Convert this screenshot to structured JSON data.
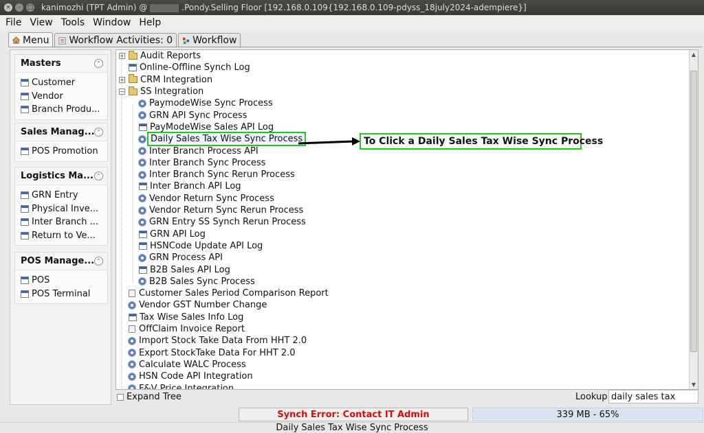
{
  "window": {
    "title_prefix": "kanimozhi (TPT Admin) @",
    "title_suffix": ".Pondy.Selling Floor [192.168.0.109{192.168.0.109-pdyss_18july2024-adempiere}]",
    "close_glyph": "×",
    "min_glyph": "–",
    "max_glyph": "□"
  },
  "menubar": [
    "File",
    "View",
    "Tools",
    "Window",
    "Help"
  ],
  "tabs": [
    {
      "label": "Menu",
      "icon": "home-icon"
    },
    {
      "label": "Workflow Activities: 0",
      "icon": "workflow-list-icon"
    },
    {
      "label": "Workflow",
      "icon": "workflow-icon"
    }
  ],
  "sidebar": {
    "masters": {
      "title": "Masters",
      "items": [
        "Customer",
        "Vendor",
        "Branch Produ..."
      ]
    },
    "sales": {
      "title": "Sales Manag...",
      "items": [
        "POS Promotion"
      ]
    },
    "logistics": {
      "title": "Logistics Ma...",
      "items": [
        "GRN Entry",
        "Physical Inve...",
        "Inter Branch ...",
        "Return to Ve..."
      ]
    },
    "pos": {
      "title": "POS Manage...",
      "items": [
        "POS",
        "POS Terminal"
      ]
    }
  },
  "tree": {
    "top": [
      {
        "label": "Audit Reports",
        "type": "folder",
        "expanded": false
      },
      {
        "label": "Online-Offline Synch Log",
        "type": "window"
      },
      {
        "label": "CRM Integration",
        "type": "folder",
        "expanded": false
      },
      {
        "label": "SS Integration",
        "type": "folder",
        "expanded": true
      }
    ],
    "ss_children": [
      {
        "label": "PaymodeWise Sync Process",
        "type": "process"
      },
      {
        "label": "GRN API Sync Process",
        "type": "process"
      },
      {
        "label": "PayModeWise Sales API Log",
        "type": "window"
      },
      {
        "label": "Daily Sales Tax Wise Sync Process",
        "type": "process",
        "selected": true
      },
      {
        "label": "Inter Branch Process API",
        "type": "process"
      },
      {
        "label": "Inter Branch Sync Process",
        "type": "process"
      },
      {
        "label": "Inter Branch Sync Rerun Process",
        "type": "process"
      },
      {
        "label": "Inter Branch API Log",
        "type": "window"
      },
      {
        "label": "Vendor Return Sync Process",
        "type": "process"
      },
      {
        "label": "Vendor Return Sync Rerun Process",
        "type": "process"
      },
      {
        "label": "GRN Entry SS Synch Rerun Process",
        "type": "process"
      },
      {
        "label": "GRN API Log",
        "type": "window"
      },
      {
        "label": "HSNCode Update API Log",
        "type": "window"
      },
      {
        "label": "GRN Process API",
        "type": "process"
      },
      {
        "label": "B2B Sales API Log",
        "type": "window"
      },
      {
        "label": "B2B Sales Sync Process",
        "type": "process"
      }
    ],
    "bottom": [
      {
        "label": "Customer Sales Period Comparison Report",
        "type": "report"
      },
      {
        "label": "Vendor GST Number Change",
        "type": "process"
      },
      {
        "label": "Tax Wise Sales Info Log",
        "type": "window"
      },
      {
        "label": "OffClaim Invoice Report",
        "type": "report"
      },
      {
        "label": "Import Stock Take Data From HHT 2.0",
        "type": "process"
      },
      {
        "label": "Export StockTake Data For HHT 2.0",
        "type": "process"
      },
      {
        "label": "Calculate WALC Process",
        "type": "process"
      },
      {
        "label": "HSN Code API Integration",
        "type": "process"
      },
      {
        "label": "F&V Price Integration",
        "type": "process"
      }
    ]
  },
  "expand_tree_label": "Expand Tree",
  "lookup": {
    "label": "Lookup",
    "value": "daily sales tax"
  },
  "status": {
    "error": "Synch Error: Contact IT Admin",
    "memory": "339 MB - 65%",
    "bottom": "Daily Sales Tax Wise Sync Process"
  },
  "annotation": {
    "text": "To Click a Daily Sales Tax Wise Sync Process",
    "color": "#24c81c"
  },
  "colors": {
    "error": "#d40e0e",
    "highlight": "#24c81c",
    "memory_bg": "#d8e4f2"
  }
}
